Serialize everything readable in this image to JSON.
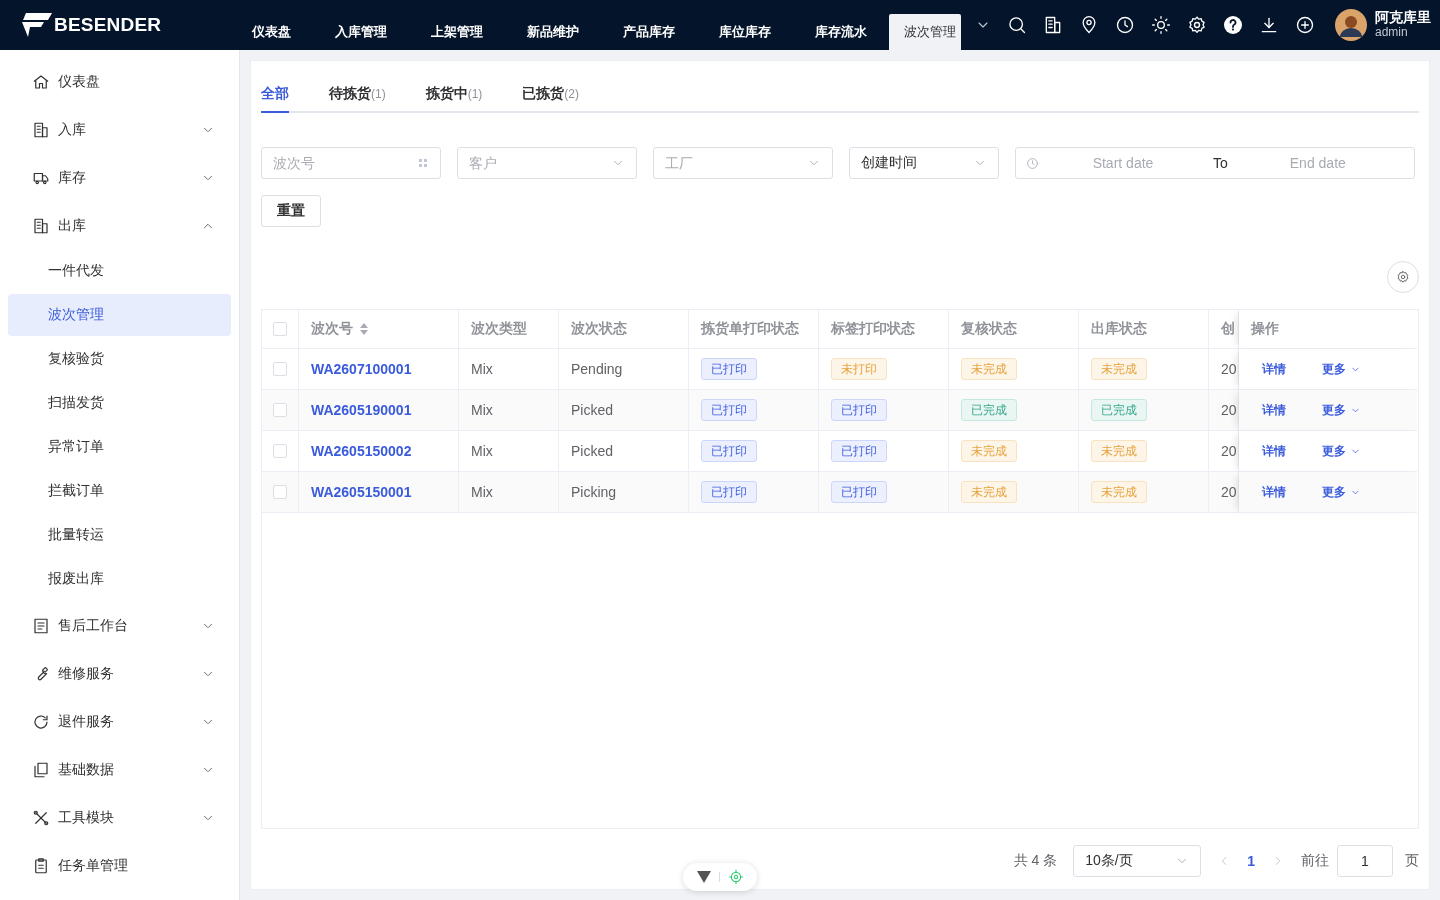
{
  "brand": "BESENDER",
  "nav": [
    {
      "label": "仪表盘",
      "selected": false
    },
    {
      "label": "入库管理",
      "selected": false
    },
    {
      "label": "上架管理",
      "selected": false
    },
    {
      "label": "新品维护",
      "selected": false
    },
    {
      "label": "产品库存",
      "selected": false
    },
    {
      "label": "库位库存",
      "selected": false
    },
    {
      "label": "库存流水",
      "selected": false
    },
    {
      "label": "波次管理",
      "selected": true
    }
  ],
  "user": {
    "name": "阿克库里",
    "role": "admin"
  },
  "sidebar": {
    "items": [
      {
        "label": "仪表盘"
      },
      {
        "label": "入库",
        "expanded": false
      },
      {
        "label": "库存",
        "expanded": false
      },
      {
        "label": "出库",
        "expanded": true,
        "children": [
          {
            "label": "一件代发",
            "selected": false
          },
          {
            "label": "波次管理",
            "selected": true
          },
          {
            "label": "复核验货",
            "selected": false
          },
          {
            "label": "扫描发货",
            "selected": false
          },
          {
            "label": "异常订单",
            "selected": false
          },
          {
            "label": "拦截订单",
            "selected": false
          },
          {
            "label": "批量转运",
            "selected": false
          },
          {
            "label": "报废出库",
            "selected": false
          }
        ]
      },
      {
        "label": "售后工作台",
        "expanded": false
      },
      {
        "label": "维修服务",
        "expanded": false
      },
      {
        "label": "退件服务",
        "expanded": false
      },
      {
        "label": "基础数据",
        "expanded": false
      },
      {
        "label": "工具模块",
        "expanded": false
      },
      {
        "label": "任务单管理"
      }
    ]
  },
  "tabs": [
    {
      "label": "全部",
      "selected": true
    },
    {
      "label": "待拣货",
      "count": "(1)",
      "selected": false
    },
    {
      "label": "拣货中",
      "count": "(1)",
      "selected": false
    },
    {
      "label": "已拣货",
      "count": "(2)",
      "selected": false
    }
  ],
  "filters": [
    {
      "kind": "input",
      "placeholder": "波次号"
    },
    {
      "kind": "select",
      "placeholder": "客户"
    },
    {
      "kind": "select",
      "placeholder": "工厂"
    },
    {
      "kind": "select",
      "value": "创建时间"
    },
    {
      "kind": "daterange",
      "start_placeholder": "Start date",
      "separator": "To",
      "end_placeholder": "End date"
    }
  ],
  "reset_button": "重置",
  "table": {
    "all_checked": false,
    "columns": [
      {
        "label": "波次号",
        "sortable": true
      },
      {
        "label": "波次类型"
      },
      {
        "label": "波次状态"
      },
      {
        "label": "拣货单打印状态"
      },
      {
        "label": "标签打印状态"
      },
      {
        "label": "复核状态"
      },
      {
        "label": "出库状态"
      },
      {
        "label": "创"
      },
      {
        "label": "操作"
      }
    ],
    "rows": [
      {
        "checked": false,
        "wave_no": "WA2607100001",
        "type": "Mix",
        "status": "Pending",
        "pick_print": {
          "text": "已打印",
          "kind": "info"
        },
        "label_print": {
          "text": "未打印",
          "kind": "warning"
        },
        "review": {
          "text": "未完成",
          "kind": "warning"
        },
        "outbound": {
          "text": "未完成",
          "kind": "warning"
        },
        "created": "20",
        "actions": [
          "详情",
          "更多"
        ]
      },
      {
        "checked": false,
        "wave_no": "WA2605190001",
        "type": "Mix",
        "status": "Picked",
        "pick_print": {
          "text": "已打印",
          "kind": "info"
        },
        "label_print": {
          "text": "已打印",
          "kind": "info"
        },
        "review": {
          "text": "已完成",
          "kind": "success"
        },
        "outbound": {
          "text": "已完成",
          "kind": "success"
        },
        "created": "20",
        "actions": [
          "详情",
          "更多"
        ]
      },
      {
        "checked": false,
        "wave_no": "WA2605150002",
        "type": "Mix",
        "status": "Picked",
        "pick_print": {
          "text": "已打印",
          "kind": "info"
        },
        "label_print": {
          "text": "已打印",
          "kind": "info"
        },
        "review": {
          "text": "未完成",
          "kind": "warning"
        },
        "outbound": {
          "text": "未完成",
          "kind": "warning"
        },
        "created": "20",
        "actions": [
          "详情",
          "更多"
        ]
      },
      {
        "checked": false,
        "wave_no": "WA2605150001",
        "type": "Mix",
        "status": "Picking",
        "pick_print": {
          "text": "已打印",
          "kind": "info"
        },
        "label_print": {
          "text": "已打印",
          "kind": "info"
        },
        "review": {
          "text": "未完成",
          "kind": "warning"
        },
        "outbound": {
          "text": "未完成",
          "kind": "warning"
        },
        "created": "20",
        "actions": [
          "详情",
          "更多"
        ]
      }
    ]
  },
  "pagination": {
    "total": "共 4 条",
    "page_size": "10条/页",
    "pages": [
      {
        "label": "1",
        "selected": true
      }
    ],
    "goto_label": "前往",
    "goto_value": "1",
    "page_suffix": "页"
  }
}
